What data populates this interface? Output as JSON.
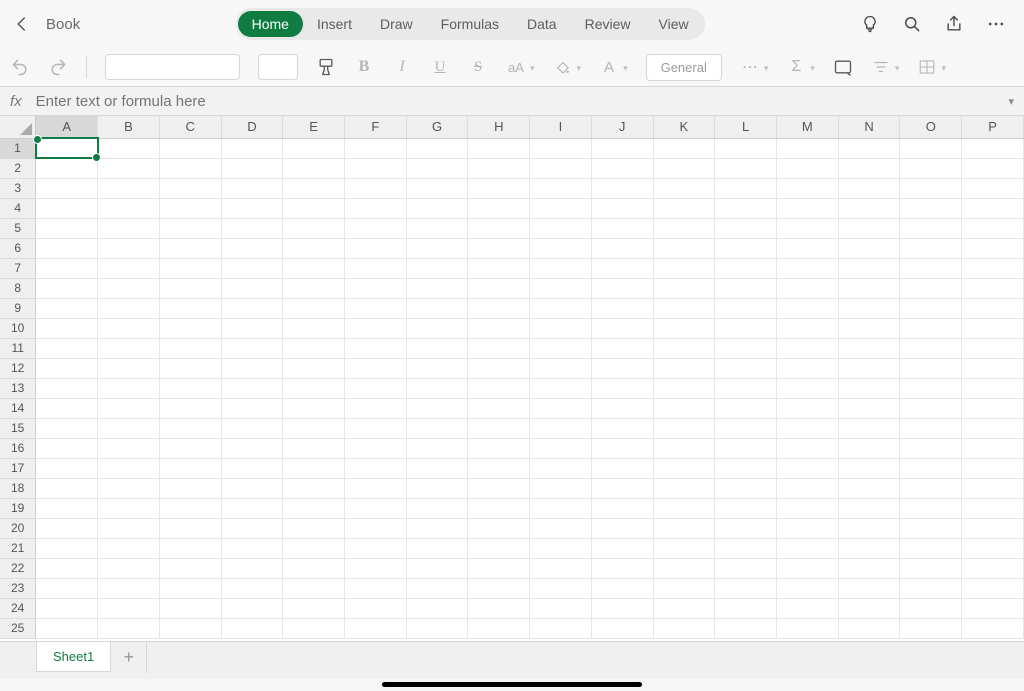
{
  "doc": {
    "name": "Book"
  },
  "ribbon": {
    "tabs": [
      "Home",
      "Insert",
      "Draw",
      "Formulas",
      "Data",
      "Review",
      "View"
    ],
    "active_index": 0
  },
  "toolbar": {
    "number_format": "General"
  },
  "formula_bar": {
    "label": "fx",
    "placeholder": "Enter text or formula here"
  },
  "grid": {
    "columns": [
      "A",
      "B",
      "C",
      "D",
      "E",
      "F",
      "G",
      "H",
      "I",
      "J",
      "K",
      "L",
      "M",
      "N",
      "O",
      "P"
    ],
    "row_count": 25,
    "selected_cell": {
      "col": "A",
      "row": 1
    }
  },
  "sheet_tabs": {
    "active": "Sheet1",
    "tabs": [
      "Sheet1"
    ]
  }
}
